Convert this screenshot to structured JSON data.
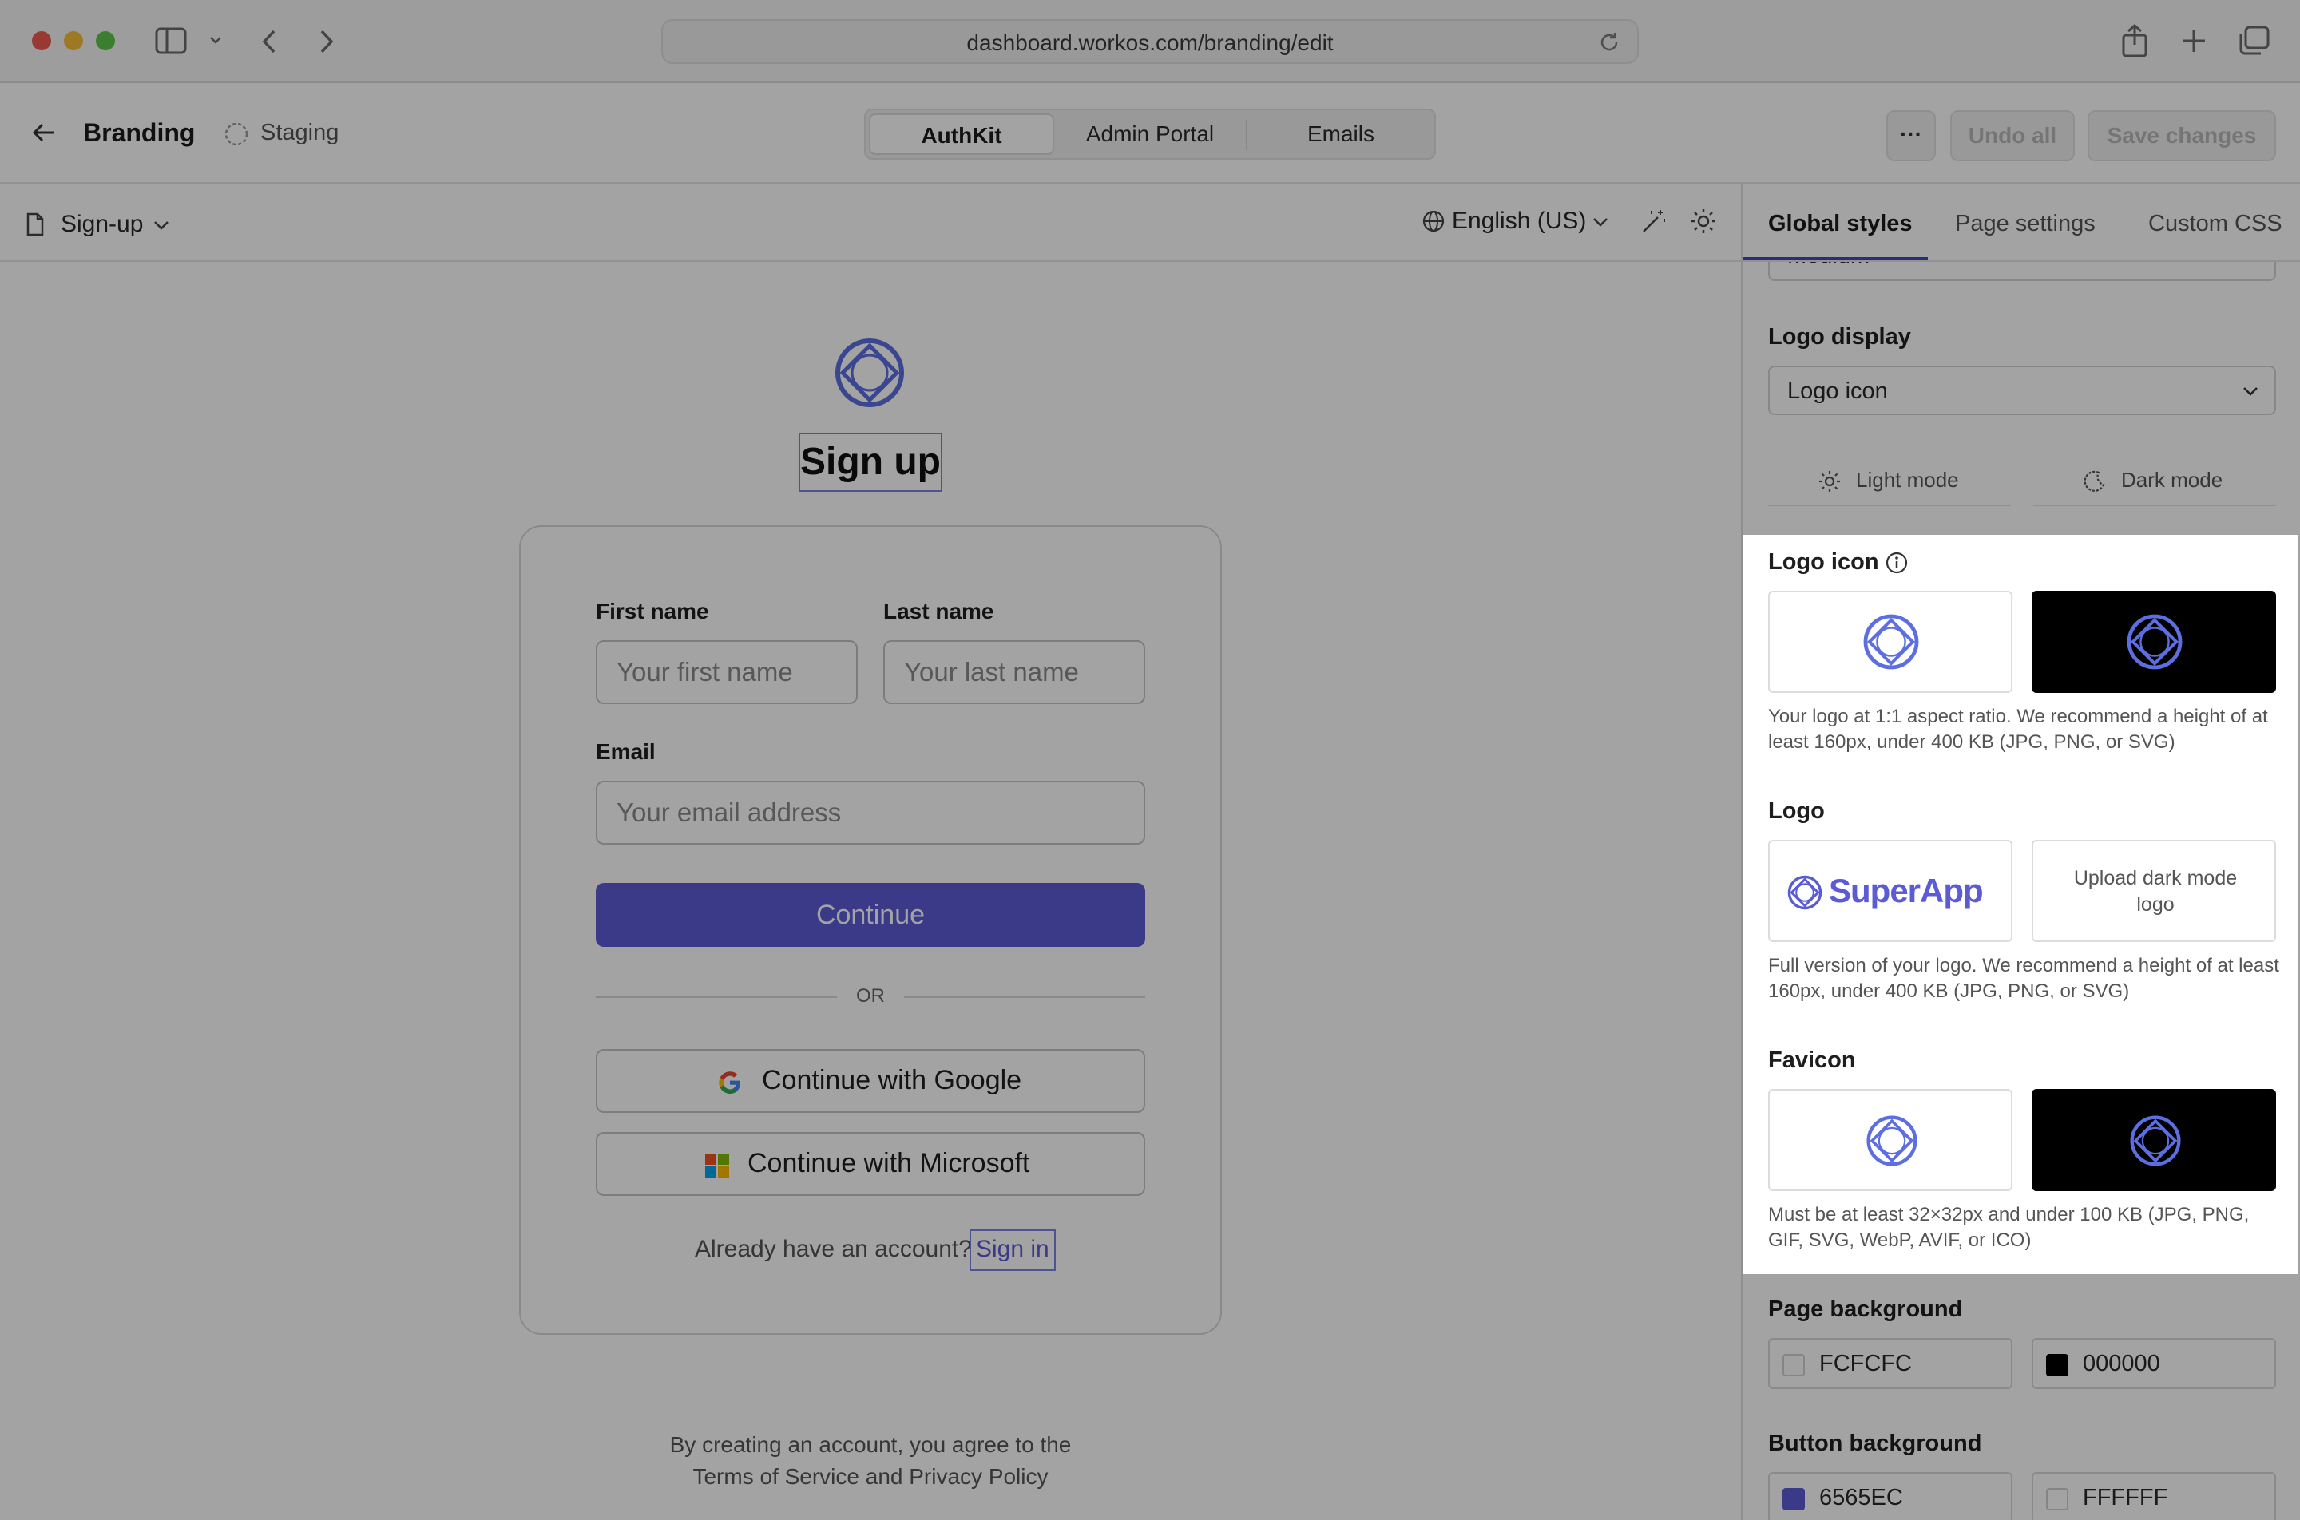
{
  "browser": {
    "url": "dashboard.workos.com/branding/edit"
  },
  "header": {
    "title": "Branding",
    "environment": "Staging",
    "tabs": [
      "AuthKit",
      "Admin Portal",
      "Emails"
    ],
    "more_label": "···",
    "undo_label": "Undo all",
    "save_label": "Save changes"
  },
  "subbar": {
    "page": "Sign-up",
    "language": "English (US)"
  },
  "preview": {
    "title": "Sign up",
    "first_name_label": "First name",
    "first_name_placeholder": "Your first name",
    "last_name_label": "Last name",
    "last_name_placeholder": "Your last name",
    "email_label": "Email",
    "email_placeholder": "Your email address",
    "continue_label": "Continue",
    "or_label": "OR",
    "google_label": "Continue with Google",
    "microsoft_label": "Continue with Microsoft",
    "account_prompt": "Already have an account?",
    "signin_label": "Sign in",
    "terms_line1": "By creating an account, you agree to the",
    "terms_line2": "Terms of Service and Privacy Policy"
  },
  "panel": {
    "tabs": [
      "Global styles",
      "Page settings",
      "Custom CSS"
    ],
    "partial_select": "Medium",
    "logo_display_label": "Logo display",
    "logo_display_value": "Logo icon",
    "mode_light": "Light mode",
    "mode_dark": "Dark mode",
    "logo_icon_label": "Logo icon",
    "logo_icon_help": "Your logo at 1:1 aspect ratio. We recommend a height of at least 160px, under 400 KB (JPG, PNG, or SVG)",
    "logo_label": "Logo",
    "logo_wordmark": "SuperApp",
    "logo_dark_upload": "Upload dark mode logo",
    "logo_help": "Full version of your logo. We recommend a height of at least 160px, under 400 KB (JPG, PNG, or SVG)",
    "favicon_label": "Favicon",
    "favicon_help": "Must be at least 32×32px and under 100 KB (JPG, PNG, GIF, SVG, WebP, AVIF, or ICO)",
    "page_bg_label": "Page background",
    "page_bg_light": "FCFCFC",
    "page_bg_dark": "000000",
    "button_bg_label": "Button background",
    "button_bg_light": "6565EC",
    "button_bg_dark": "FFFFFF"
  },
  "colors": {
    "brand": "#6565EC",
    "brand_button": "#5b5bd6",
    "logo_stroke": "#5c6ee0",
    "overlay": "rgba(0,0,0,0.36)"
  }
}
